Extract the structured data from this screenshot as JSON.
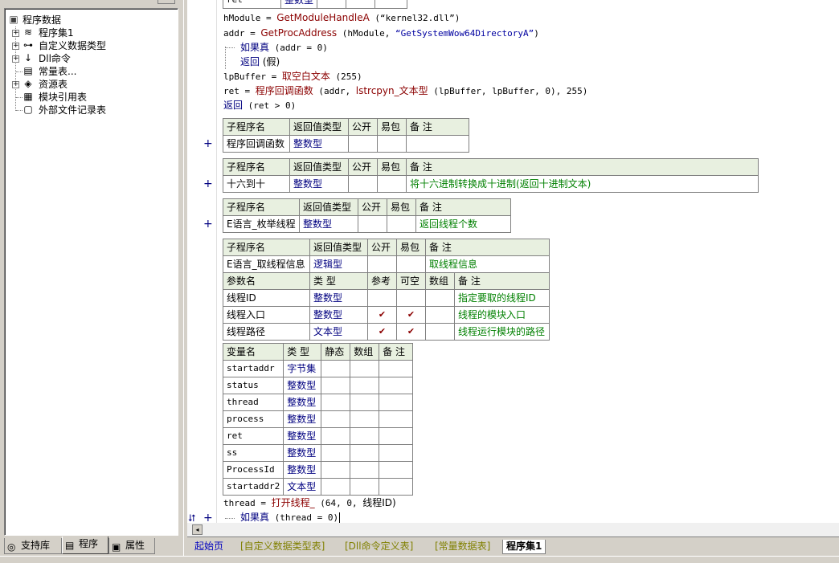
{
  "tree": {
    "root": "程序数据",
    "items": [
      {
        "label": "程序集1",
        "icon": "layers-icon"
      },
      {
        "label": "自定义数据类型",
        "icon": "datatype-icon"
      },
      {
        "label": "Dll命令",
        "icon": "dll-icon"
      },
      {
        "label": "常量表...",
        "icon": "constant-icon"
      },
      {
        "label": "资源表",
        "icon": "resource-icon"
      },
      {
        "label": "模块引用表",
        "icon": "module-icon"
      },
      {
        "label": "外部文件记录表",
        "icon": "file-icon"
      }
    ]
  },
  "left_tabs": [
    {
      "label": "支持库"
    },
    {
      "label": "程序"
    },
    {
      "label": "属性"
    }
  ],
  "code_top": {
    "partial_row": {
      "name": "ret",
      "type": "整数型"
    },
    "l1": {
      "a": "hModule = ",
      "fn": "GetModuleHandleA",
      "b": " (“kernel32.dll”)"
    },
    "l2": {
      "a": "addr = ",
      "fn": "GetProcAddress",
      "b": " (hModule, ",
      "s": "“GetSystemWow64DirectoryA”",
      ")": ")"
    },
    "l3": {
      "kw": "如果真",
      "b": " (addr = 0)"
    },
    "l4": {
      "kw": "返回",
      "b": " (假)"
    },
    "l5": {
      "a": "lpBuffer = ",
      "fn": "取空白文本",
      "b": " (255)"
    },
    "l6": {
      "a": "ret = ",
      "fn": "程序回调函数",
      "b": " (addr, ",
      "fn2": "lstrcpyn_文本型",
      "c": " (lpBuffer, lpBuffer, 0), 255)"
    },
    "l7": {
      "kw": "返回",
      "b": " (ret > 0)"
    }
  },
  "sub_headers": {
    "name": "子程序名",
    "ret": "返回值类型",
    "pub": "公开",
    "easy": "易包",
    "note": "备 注"
  },
  "subs": [
    {
      "name": "程序回调函数",
      "ret": "整数型",
      "note": ""
    },
    {
      "name": "十六到十",
      "ret": "整数型",
      "note": "将十六进制转换成十进制(返回十进制文本)"
    },
    {
      "name": "E语言_枚举线程",
      "ret": "整数型",
      "note": "返回线程个数"
    },
    {
      "name": "E语言_取线程信息",
      "ret": "逻辑型",
      "note": "取线程信息"
    }
  ],
  "param_headers": {
    "name": "参数名",
    "type": "类 型",
    "ref": "参考",
    "opt": "可空",
    "arr": "数组",
    "note": "备 注"
  },
  "params": [
    {
      "name": "线程ID",
      "type": "整数型",
      "ref": "",
      "opt": "",
      "note": "指定要取的线程ID"
    },
    {
      "name": "线程入口",
      "type": "整数型",
      "ref": "✔",
      "opt": "✔",
      "note": "线程的模块入口"
    },
    {
      "name": "线程路径",
      "type": "文本型",
      "ref": "✔",
      "opt": "✔",
      "note": "线程运行模块的路径"
    }
  ],
  "var_headers": {
    "name": "变量名",
    "type": "类 型",
    "static": "静态",
    "arr": "数组",
    "note": "备 注"
  },
  "vars": [
    {
      "name": "startaddr",
      "type": "字节集"
    },
    {
      "name": "status",
      "type": "整数型"
    },
    {
      "name": "thread",
      "type": "整数型"
    },
    {
      "name": "process",
      "type": "整数型"
    },
    {
      "name": "ret",
      "type": "整数型"
    },
    {
      "name": "ss",
      "type": "整数型"
    },
    {
      "name": "ProcessId",
      "type": "整数型"
    },
    {
      "name": "startaddr2",
      "type": "文本型"
    }
  ],
  "code_bottom": {
    "l1": {
      "a": "thread = ",
      "fn": "打开线程_",
      "b": " (64, 0, ",
      "c": "线程ID)"
    },
    "l2": {
      "kw": "如果真",
      "b": " (thread = 0)"
    }
  },
  "bottom_tabs": [
    {
      "label": "起始页"
    },
    {
      "label": "[自定义数据类型表]"
    },
    {
      "label": "[Dll命令定义表]"
    },
    {
      "label": "[常量数据表]"
    },
    {
      "label": "程序集1"
    }
  ]
}
